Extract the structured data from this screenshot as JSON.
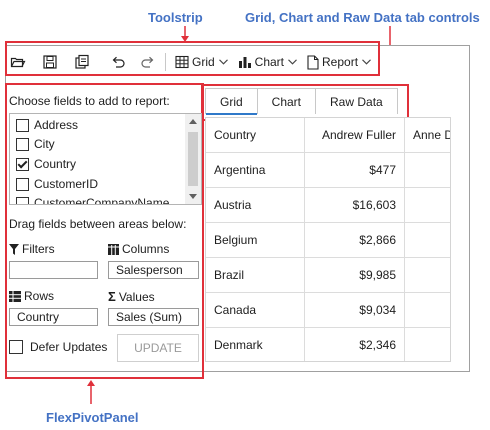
{
  "annotations": {
    "toolstrip": "Toolstrip",
    "tab_controls": "Grid, Chart and Raw Data tab controls",
    "pivot_panel": "FlexPivotPanel"
  },
  "toolbar": {
    "items": [
      {
        "icon": "folder-open-icon"
      },
      {
        "icon": "save-icon"
      },
      {
        "icon": "export-icon"
      },
      {
        "icon": "undo-icon"
      },
      {
        "icon": "redo-icon"
      }
    ],
    "grid_label": "Grid",
    "chart_label": "Chart",
    "report_label": "Report"
  },
  "panel": {
    "heading": "Choose fields to add to report:",
    "fields": [
      {
        "label": "Address",
        "checked": false
      },
      {
        "label": "City",
        "checked": false
      },
      {
        "label": "Country",
        "checked": true
      },
      {
        "label": "CustomerID",
        "checked": false
      },
      {
        "label": "CustomerCompanyName",
        "checked": false
      }
    ],
    "drag_heading": "Drag fields between areas below:",
    "filters_label": "Filters",
    "filters_value": "",
    "columns_label": "Columns",
    "columns_value": "Salesperson",
    "rows_label": "Rows",
    "rows_value": "Country",
    "values_label": "Values",
    "values_value": "Sales (Sum)",
    "defer_label": "Defer Updates",
    "update_label": "UPDATE"
  },
  "tabs": [
    "Grid",
    "Chart",
    "Raw Data"
  ],
  "grid": {
    "columns": [
      "Country",
      "Andrew Fuller",
      "Anne D"
    ],
    "rows": [
      {
        "country": "Argentina",
        "andrew_fuller": "$477"
      },
      {
        "country": "Austria",
        "andrew_fuller": "$16,603"
      },
      {
        "country": "Belgium",
        "andrew_fuller": "$2,866"
      },
      {
        "country": "Brazil",
        "andrew_fuller": "$9,985"
      },
      {
        "country": "Canada",
        "andrew_fuller": "$9,034"
      },
      {
        "country": "Denmark",
        "andrew_fuller": "$2,346"
      }
    ]
  },
  "colors": {
    "annotation": "#4472c4",
    "highlight_box": "#e0303a",
    "tab_accent": "#2f79c9"
  }
}
